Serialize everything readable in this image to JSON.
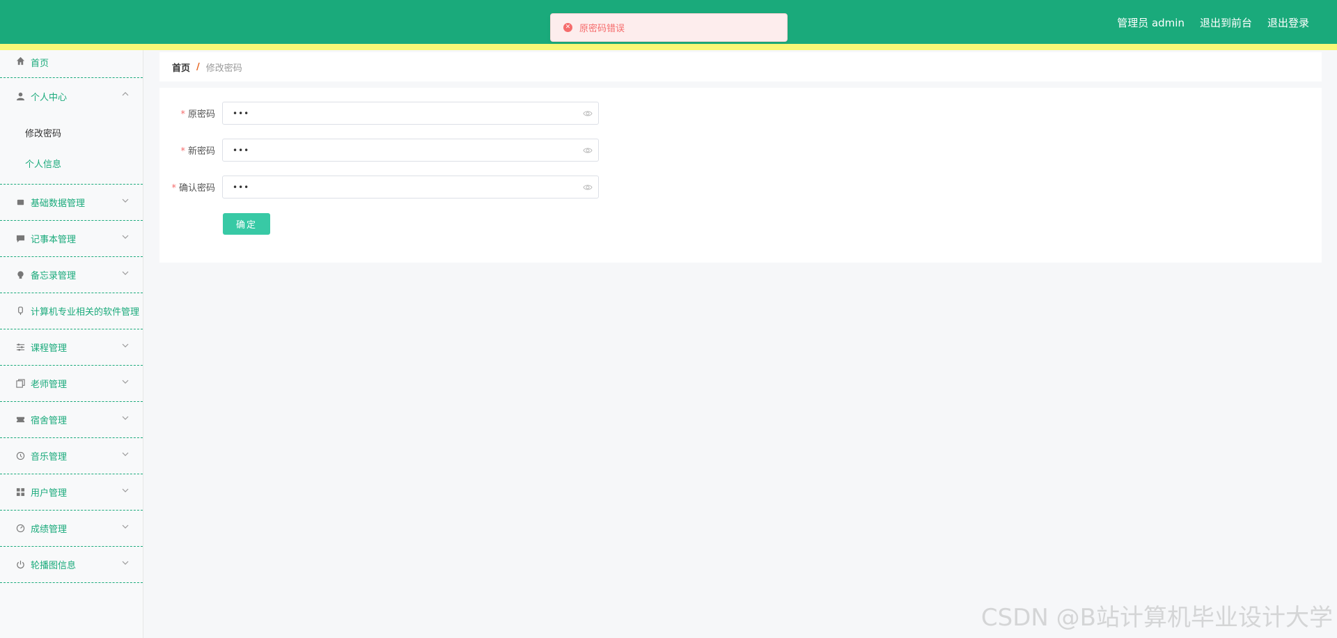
{
  "header": {
    "admin_label": "管理员 admin",
    "exit_front_label": "退出到前台",
    "logout_label": "退出登录",
    "bg_color": "#1aaa7b",
    "stripe_color": "#f8f878"
  },
  "toast": {
    "message": "原密码错误",
    "type": "error"
  },
  "sidebar": {
    "home": {
      "label": "首页",
      "icon": "home-icon"
    },
    "personal_center": {
      "label": "个人中心",
      "icon": "user-icon",
      "expanded": true,
      "children": [
        {
          "label": "修改密码",
          "active": true
        },
        {
          "label": "个人信息",
          "active": false
        }
      ]
    },
    "items": [
      {
        "label": "基础数据管理",
        "icon": "box-icon"
      },
      {
        "label": "记事本管理",
        "icon": "comment-icon"
      },
      {
        "label": "备忘录管理",
        "icon": "bulb-icon"
      },
      {
        "label": "计算机专业相关的软件管理",
        "icon": "mic-icon"
      },
      {
        "label": "课程管理",
        "icon": "sliders-icon"
      },
      {
        "label": "老师管理",
        "icon": "copy-icon"
      },
      {
        "label": "宿舍管理",
        "icon": "ticket-icon"
      },
      {
        "label": "音乐管理",
        "icon": "clock-icon"
      },
      {
        "label": "用户管理",
        "icon": "grid-icon"
      },
      {
        "label": "成绩管理",
        "icon": "gauge-icon"
      },
      {
        "label": "轮播图信息",
        "icon": "power-icon"
      }
    ]
  },
  "breadcrumb": {
    "home": "首页",
    "separator": "/",
    "current": "修改密码"
  },
  "form": {
    "old_password": {
      "label": "原密码",
      "value": "•••"
    },
    "new_password": {
      "label": "新密码",
      "value": "•••"
    },
    "confirm_password": {
      "label": "确认密码",
      "value": "•••"
    },
    "submit_label": "确定"
  },
  "watermark": "CSDN @B站计算机毕业设计大学"
}
